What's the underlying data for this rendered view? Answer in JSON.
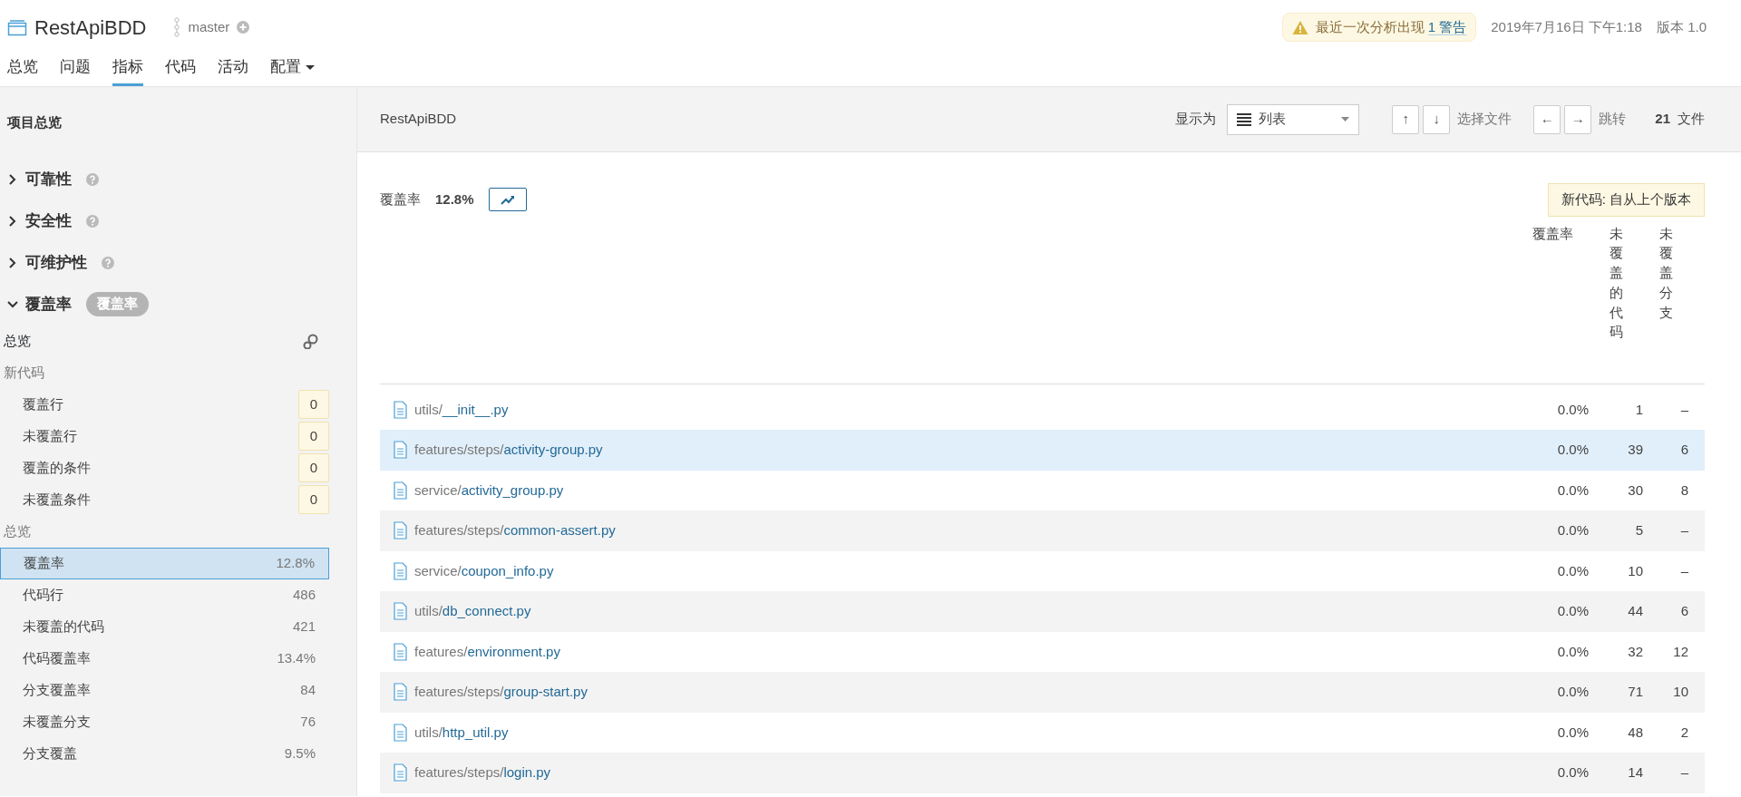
{
  "header": {
    "project": "RestApiBDD",
    "branch": "master",
    "warning": {
      "text": "最近一次分析出现",
      "link": "1 警告"
    },
    "date": "2019年7月16日 下午1:18",
    "version": "版本 1.0",
    "tabs": [
      {
        "label": "总览",
        "selected": false,
        "kind": "plain"
      },
      {
        "label": "问题",
        "selected": false,
        "kind": "plain"
      },
      {
        "label": "指标",
        "selected": true,
        "kind": "plain"
      },
      {
        "label": "代码",
        "selected": false,
        "kind": "plain"
      },
      {
        "label": "活动",
        "selected": false,
        "kind": "plain"
      },
      {
        "label": "配置",
        "selected": false,
        "kind": "dropdown"
      }
    ]
  },
  "sidebar": {
    "title": "项目总览",
    "sections": [
      {
        "label": "可靠性",
        "expanded": false,
        "help": true
      },
      {
        "label": "安全性",
        "expanded": false,
        "help": true
      },
      {
        "label": "可维护性",
        "expanded": false,
        "help": true
      },
      {
        "label": "覆盖率",
        "expanded": true,
        "help": false,
        "tag": "覆盖率"
      }
    ],
    "overview_label": "总览",
    "new_code": {
      "label": "新代码",
      "items": [
        {
          "label": "覆盖行",
          "value": "0"
        },
        {
          "label": "未覆盖行",
          "value": "0"
        },
        {
          "label": "覆盖的条件",
          "value": "0"
        },
        {
          "label": "未覆盖条件",
          "value": "0"
        }
      ]
    },
    "overall": {
      "label": "总览",
      "items": [
        {
          "label": "覆盖率",
          "value": "12.8%",
          "selected": true
        },
        {
          "label": "代码行",
          "value": "486",
          "selected": false
        },
        {
          "label": "未覆盖的代码",
          "value": "421",
          "selected": false
        },
        {
          "label": "代码覆盖率",
          "value": "13.4%",
          "selected": false
        },
        {
          "label": "分支覆盖率",
          "value": "84",
          "selected": false
        },
        {
          "label": "未覆盖分支",
          "value": "76",
          "selected": false
        },
        {
          "label": "分支覆盖",
          "value": "9.5%",
          "selected": false
        }
      ]
    }
  },
  "main": {
    "toolbar": {
      "title": "RestApiBDD",
      "display_label": "显示为",
      "display_value": "列表",
      "up": "↑",
      "down": "↓",
      "select_label": "选择文件",
      "left": "←",
      "right": "→",
      "jump_label": "跳转",
      "file_count": "21",
      "file_label": "文件"
    },
    "coverage_label": "覆盖率",
    "coverage_value": "12.8%",
    "new_code_badge": "新代码: 自从上个版本",
    "columns": [
      {
        "label": "覆盖率",
        "kind": "horizontal"
      },
      {
        "label": "未覆盖的代码",
        "kind": "vertical"
      },
      {
        "label": "未覆盖分支",
        "kind": "vertical"
      }
    ],
    "rows": [
      {
        "dir": "utils/",
        "name": "__init__.py",
        "coverage": "0.0%",
        "uncovered_lines": "1",
        "uncovered_branches": "–",
        "selected": false
      },
      {
        "dir": "features/steps/",
        "name": "activity-group.py",
        "coverage": "0.0%",
        "uncovered_lines": "39",
        "uncovered_branches": "6",
        "selected": true
      },
      {
        "dir": "service/",
        "name": "activity_group.py",
        "coverage": "0.0%",
        "uncovered_lines": "30",
        "uncovered_branches": "8",
        "selected": false
      },
      {
        "dir": "features/steps/",
        "name": "common-assert.py",
        "coverage": "0.0%",
        "uncovered_lines": "5",
        "uncovered_branches": "–",
        "selected": false
      },
      {
        "dir": "service/",
        "name": "coupon_info.py",
        "coverage": "0.0%",
        "uncovered_lines": "10",
        "uncovered_branches": "–",
        "selected": false
      },
      {
        "dir": "utils/",
        "name": "db_connect.py",
        "coverage": "0.0%",
        "uncovered_lines": "44",
        "uncovered_branches": "6",
        "selected": false
      },
      {
        "dir": "features/",
        "name": "environment.py",
        "coverage": "0.0%",
        "uncovered_lines": "32",
        "uncovered_branches": "12",
        "selected": false
      },
      {
        "dir": "features/steps/",
        "name": "group-start.py",
        "coverage": "0.0%",
        "uncovered_lines": "71",
        "uncovered_branches": "10",
        "selected": false
      },
      {
        "dir": "utils/",
        "name": "http_util.py",
        "coverage": "0.0%",
        "uncovered_lines": "48",
        "uncovered_branches": "2",
        "selected": false
      },
      {
        "dir": "features/steps/",
        "name": "login.py",
        "coverage": "0.0%",
        "uncovered_lines": "14",
        "uncovered_branches": "–",
        "selected": false
      }
    ]
  }
}
